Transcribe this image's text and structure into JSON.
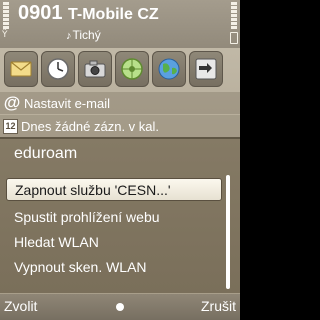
{
  "status_bar": {
    "clock": "0901",
    "operator": "T-Mobile CZ",
    "profile": "Tichý",
    "signal_level": 1.0,
    "battery_level": 1.0
  },
  "shortcuts": [
    {
      "name": "messaging",
      "icon": "envelope-icon"
    },
    {
      "name": "clock",
      "icon": "clock-icon"
    },
    {
      "name": "camera",
      "icon": "camera-icon"
    },
    {
      "name": "settings",
      "icon": "wheel-icon"
    },
    {
      "name": "web",
      "icon": "globe-icon"
    },
    {
      "name": "connectivity",
      "icon": "transfer-icon"
    }
  ],
  "info": {
    "email_text": "Nastavit e-mail",
    "calendar_text": "Dnes žádné zázn. v kal.",
    "calendar_day": "12"
  },
  "popup": {
    "title": "eduroam",
    "items": [
      "Zapnout službu 'CESN...'",
      "Spustit prohlížení webu",
      "Hledat WLAN",
      "Vypnout sken. WLAN"
    ],
    "selected_index": 0
  },
  "softkeys": {
    "left": "Zvolit",
    "right": "Zrušit"
  }
}
